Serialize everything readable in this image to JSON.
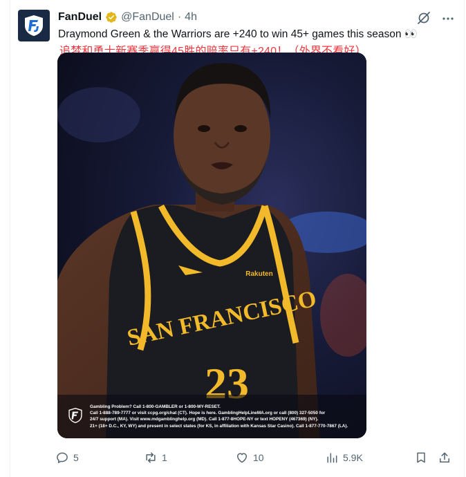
{
  "tweet": {
    "author_name": "FanDuel",
    "handle": "@FanDuel",
    "separator": "·",
    "time": "4h",
    "text": "Draymond Green & the Warriors are +240 to win 45+ games this season 👀",
    "annotation": "追梦和勇士新赛季赢得45胜的赔率只有+240！（外界不看好）",
    "image": {
      "jersey_city": "SAN FRANCISCO",
      "jersey_number": "23",
      "jersey_sponsor": "Rakuten",
      "disclaimer_lines": [
        "Gambling Problem? Call 1-800-GAMBLER or 1-800-MY-RESET.",
        "Call 1-888-789-7777 or visit ccpg.org/chat (CT). Hope is here. GamblingHelpLineMA.org or call (800) 327-5050 for",
        "24/7 support (MA). Visit www.mdgamblinghelp.org (MD). Call 1-877-8HOPE-NY or text HOPENY (467369) (NY).",
        "21+ (18+ D.C., KY, WY) and present in select states (for KS, in affiliation with Kansas Star Casino). Call 1-877-770-7867 (LA)."
      ]
    }
  },
  "actions": {
    "replies": "5",
    "reposts": "1",
    "likes": "10",
    "views": "5.9K"
  },
  "icons": {
    "avatar": "fanduel-shield-logo",
    "verified": "gold-verified-badge",
    "grok": "grok-icon",
    "more": "more-horizontal-icon",
    "reply": "reply-icon",
    "repost": "repost-icon",
    "like": "heart-icon",
    "views": "views-chart-icon",
    "bookmark": "bookmark-icon",
    "share": "share-icon"
  },
  "colors": {
    "annotation": "#e8383d",
    "verified": "#e2b719",
    "jersey_gold": "#f2b92b",
    "secondary_text": "#536471"
  }
}
